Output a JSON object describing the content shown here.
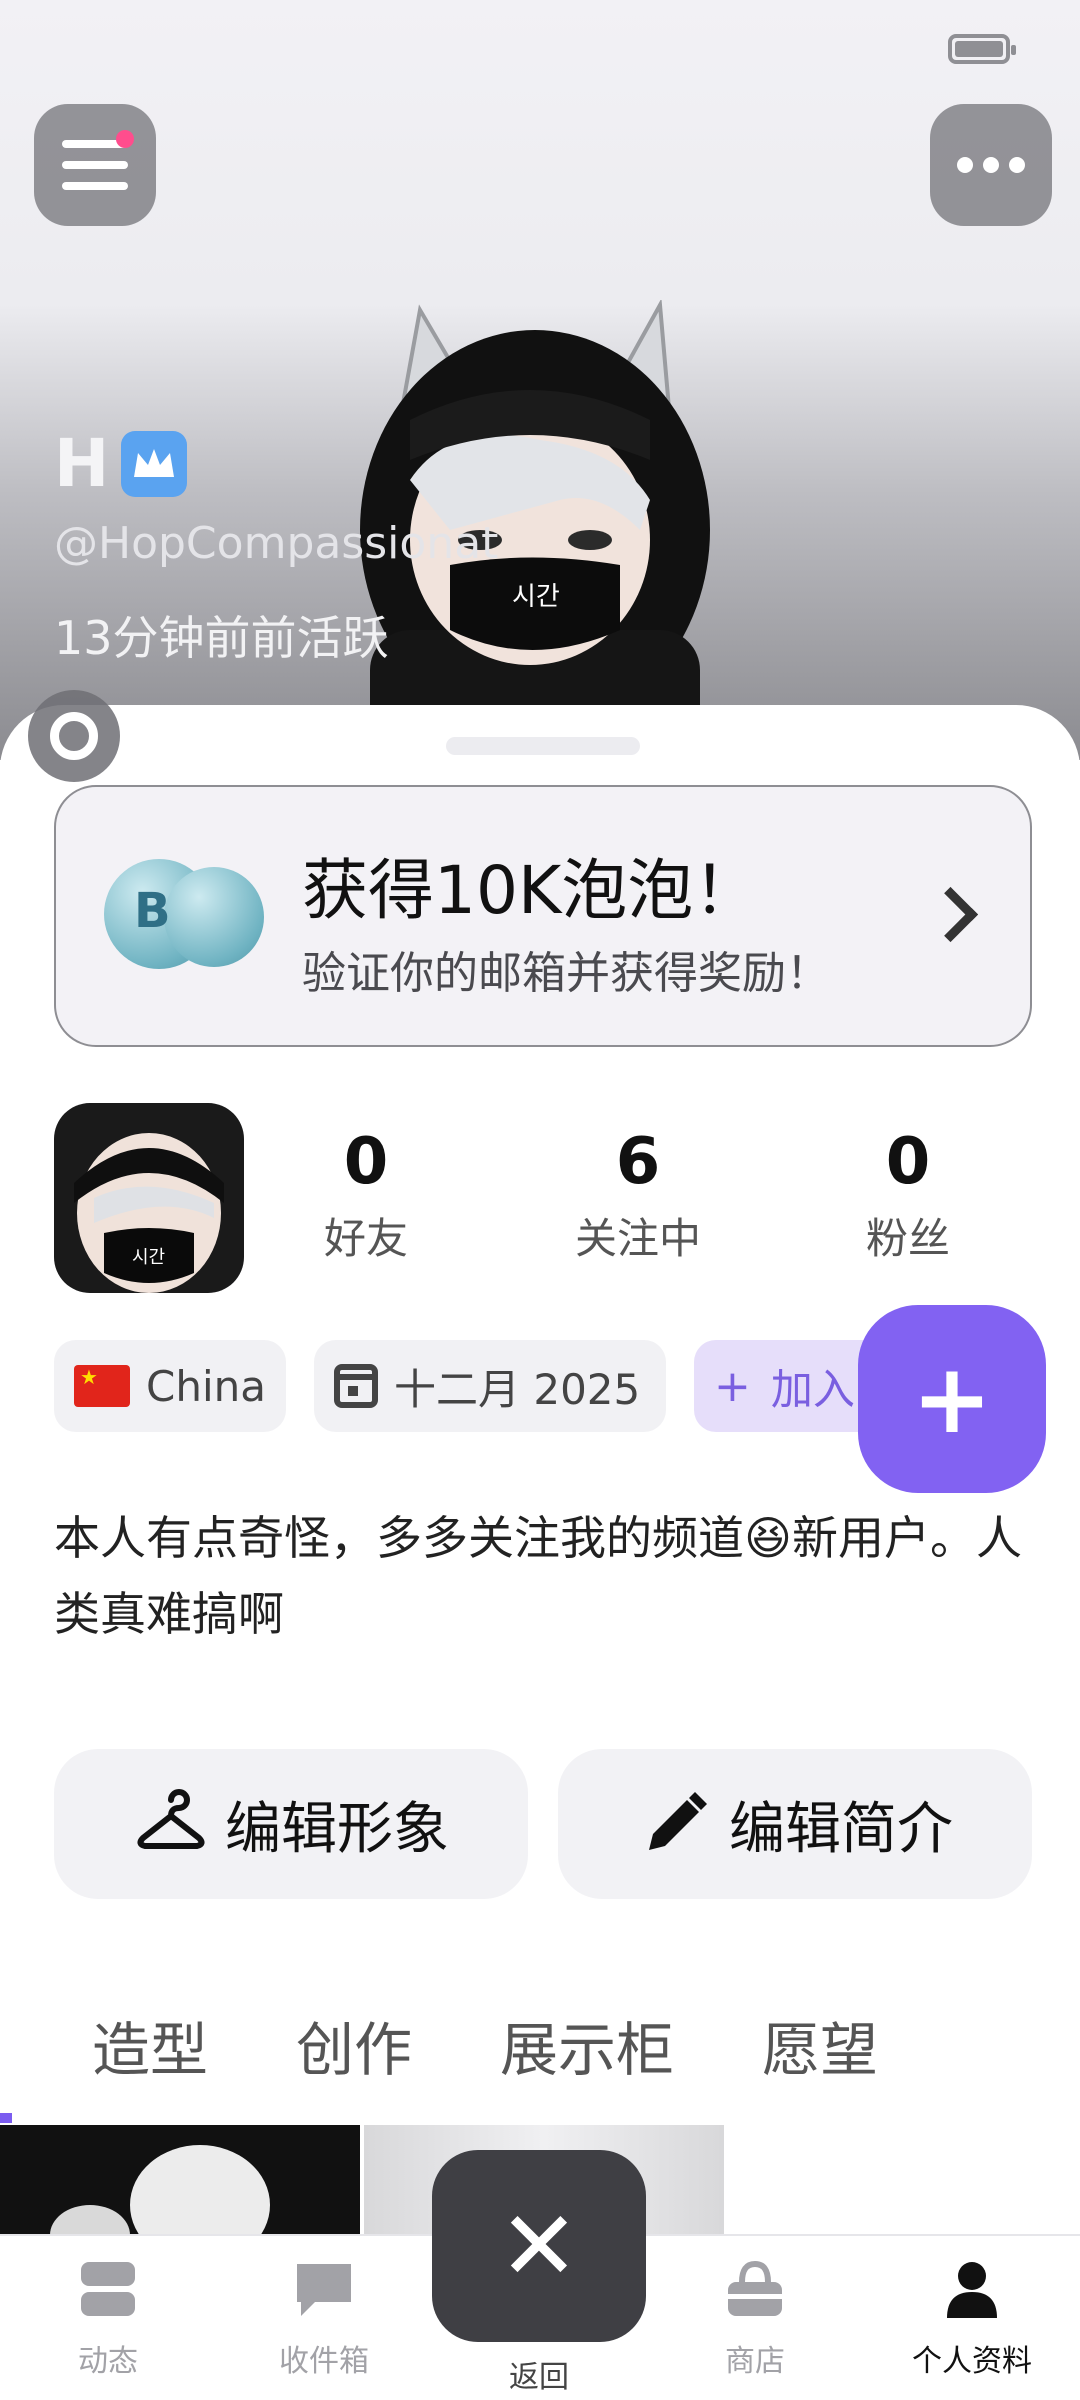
{
  "header": {
    "display_name": "H",
    "handle": "@HopCompassionat",
    "activity": "13分钟前前活跃"
  },
  "reward": {
    "bubble_letter": "B",
    "title": "获得10K泡泡！",
    "subtitle": "验证你的邮箱并获得奖励！"
  },
  "stats": [
    {
      "value": "0",
      "label": "好友"
    },
    {
      "value": "6",
      "label": "关注中"
    },
    {
      "value": "0",
      "label": "粉丝"
    }
  ],
  "chips": {
    "country": "China",
    "joined": "十二月 2025",
    "team_plus": "+",
    "team": "加入团队"
  },
  "bio": "本人有点奇怪，多多关注我的频道😆新用户。人类真难搞啊",
  "actions": {
    "edit_avatar": "编辑形象",
    "edit_bio": "编辑简介"
  },
  "tabs": [
    "造型",
    "创作",
    "展示柜",
    "愿望"
  ],
  "fab_label": "+",
  "bottom_nav": {
    "items": [
      {
        "label": "动态",
        "icon": "feed-icon"
      },
      {
        "label": "收件箱",
        "icon": "chat-bubble-icon"
      },
      {
        "label": "返回",
        "icon": "close-icon"
      },
      {
        "label": "商店",
        "icon": "shop-basket-icon"
      },
      {
        "label": "个人资料",
        "icon": "person-icon"
      }
    ],
    "active": "个人资料"
  },
  "colors": {
    "accent": "#8262f2",
    "team_chip_bg": "#e6defa",
    "crown_badge": "#5aa3f0",
    "notif_dot": "#ff4d8d"
  }
}
